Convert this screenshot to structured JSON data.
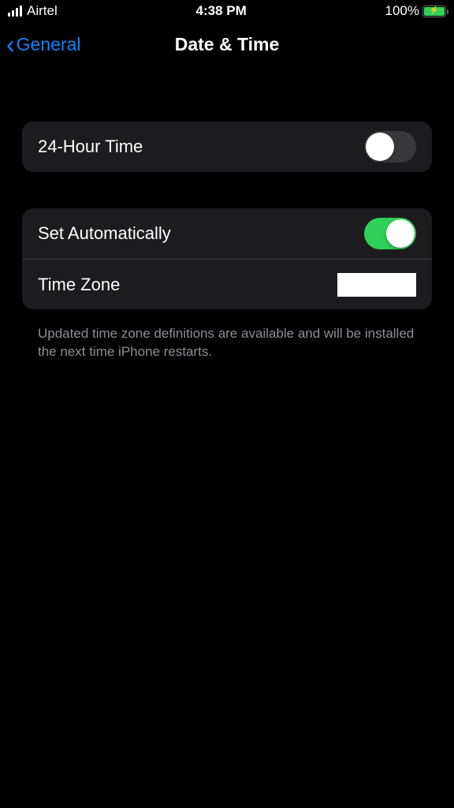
{
  "status_bar": {
    "carrier": "Airtel",
    "time": "4:38 PM",
    "battery_pct": "100%"
  },
  "nav": {
    "back_label": "General",
    "title": "Date & Time"
  },
  "settings": {
    "twenty_four_hour_label": "24-Hour Time",
    "set_automatically_label": "Set Automatically",
    "time_zone_label": "Time Zone"
  },
  "footer": {
    "text": "Updated time zone definitions are available and will be installed the next time iPhone restarts."
  }
}
